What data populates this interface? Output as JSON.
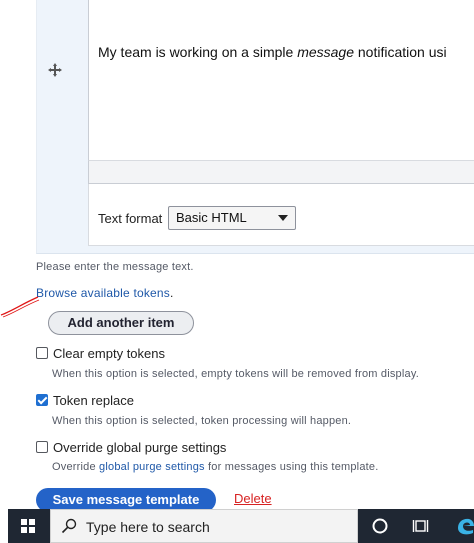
{
  "editor": {
    "text_before": "My team is working on a simple ",
    "text_em": "message",
    "text_after": " notification usi",
    "text_format_label": "Text format",
    "text_format_value": "Basic HTML"
  },
  "help_text": "Please enter the message text.",
  "tokens_link": "Browse available tokens",
  "tokens_period": ".",
  "add_item_button": "Add another item",
  "options": [
    {
      "label": "Clear empty tokens",
      "checked": false,
      "description": "When this option is selected, empty tokens will be removed from display."
    },
    {
      "label": "Token replace",
      "checked": true,
      "description": "When this option is selected, token processing will happen."
    },
    {
      "label": "Override global purge settings",
      "checked": false,
      "description_prefix": "Override ",
      "description_link": "global purge settings",
      "description_suffix": " for messages using this template."
    }
  ],
  "save_button": "Save message template",
  "delete_link": "Delete",
  "taskbar": {
    "search_placeholder": "Type here to search",
    "icons": [
      "windows-start-icon",
      "search-icon",
      "cortana-icon",
      "task-view-icon",
      "edge-icon"
    ]
  },
  "colors": {
    "primary_button": "#2463c8",
    "link": "#1f58a8",
    "delete": "#d72222",
    "taskbar": "#1f2733",
    "row_background": "#eef4fb"
  }
}
